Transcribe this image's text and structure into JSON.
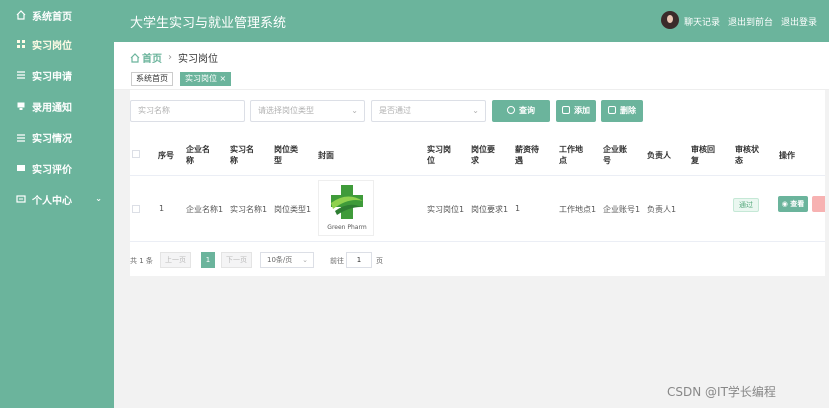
{
  "app": {
    "title": "大学生实习与就业管理系统"
  },
  "header": {
    "links": [
      "聊天记录",
      "退出到前台",
      "退出登录"
    ]
  },
  "sidebar": {
    "items": [
      {
        "label": "系统首页",
        "icon": "home-icon"
      },
      {
        "label": "实习岗位",
        "icon": "grid-icon"
      },
      {
        "label": "实习申请",
        "icon": "list-icon"
      },
      {
        "label": "录用通知",
        "icon": "doc-icon"
      },
      {
        "label": "实习情况",
        "icon": "chart-icon"
      },
      {
        "label": "实习评价",
        "icon": "star-icon"
      },
      {
        "label": "个人中心",
        "icon": "user-icon"
      }
    ]
  },
  "breadcrumb": {
    "home": "首页",
    "current": "实习岗位"
  },
  "tabs": [
    {
      "label": "系统首页"
    },
    {
      "label": "实习岗位 ×"
    }
  ],
  "filters": {
    "name_placeholder": "实习名称",
    "type_placeholder": "请选择岗位类型",
    "passed_placeholder": "是否通过"
  },
  "buttons": {
    "search": "查询",
    "add": "添加",
    "delete": "删除"
  },
  "table": {
    "headers": [
      "序号",
      "企业名称",
      "实习名称",
      "岗位类型",
      "封面",
      "实习岗位",
      "岗位要求",
      "薪资待遇",
      "工作地点",
      "企业账号",
      "负责人",
      "审核回复",
      "审核状态",
      "操作"
    ],
    "rows": [
      {
        "index": "1",
        "company": "企业名称1",
        "internship": "实习名称1",
        "post_type": "岗位类型1",
        "cover_text": "Green Pharm",
        "post": "实习岗位1",
        "requirement": "岗位要求1",
        "salary": "1",
        "location": "工作地点1",
        "account": "企业账号1",
        "owner": "负责人1",
        "reply": "",
        "status": "通过",
        "view_label": "查看"
      }
    ]
  },
  "pager": {
    "total": "共 1 条",
    "prev": "上一页",
    "page": "1",
    "next": "下一页",
    "size": "10条/页",
    "goto": "前往",
    "goto_value": "1",
    "page_unit": "页"
  },
  "watermark": "CSDN @IT学长编程",
  "colors": {
    "accent": "#6bb49c",
    "badge_text": "#55a87c",
    "danger": "#f7b2b2"
  }
}
